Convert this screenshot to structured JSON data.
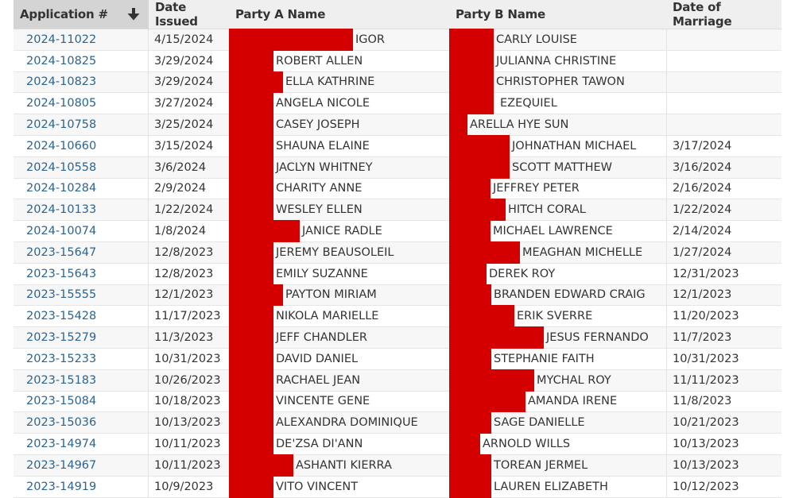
{
  "table": {
    "columns": [
      {
        "label": "Application #",
        "sorted": "descending"
      },
      {
        "label": "Date Issued"
      },
      {
        "label": "Party A Name"
      },
      {
        "label": "Party B Name"
      },
      {
        "label": "Date of Marriage"
      }
    ],
    "colors": {
      "link": "#2a6496",
      "redaction": "#d40000",
      "header_bg": "#efefef",
      "sorted_header_bg": "#d4d4d4"
    },
    "rows": [
      {
        "app": "2024-11022",
        "issued": "4/15/2024",
        "party_a": "IGOR",
        "party_b": "CARLY LOUISE",
        "married": ""
      },
      {
        "app": "2024-10825",
        "issued": "3/29/2024",
        "party_a": "ROBERT ALLEN",
        "party_b": "JULIANNA CHRISTINE",
        "married": ""
      },
      {
        "app": "2024-10823",
        "issued": "3/29/2024",
        "party_a": "ELLA KATHRINE",
        "party_b": "CHRISTOPHER TAWON",
        "married": ""
      },
      {
        "app": "2024-10805",
        "issued": "3/27/2024",
        "party_a": "ANGELA NICOLE",
        "party_b": "EZEQUIEL",
        "married": ""
      },
      {
        "app": "2024-10758",
        "issued": "3/25/2024",
        "party_a": "CASEY JOSEPH",
        "party_b": "ARELLA HYE SUN",
        "married": ""
      },
      {
        "app": "2024-10660",
        "issued": "3/15/2024",
        "party_a": "SHAUNA ELAINE",
        "party_b": "JOHNATHAN MICHAEL",
        "married": "3/17/2024"
      },
      {
        "app": "2024-10558",
        "issued": "3/6/2024",
        "party_a": "JACLYN WHITNEY",
        "party_b": "SCOTT MATTHEW",
        "married": "3/16/2024"
      },
      {
        "app": "2024-10284",
        "issued": "2/9/2024",
        "party_a": "CHARITY ANNE",
        "party_b": "JEFFREY PETER",
        "married": "2/16/2024"
      },
      {
        "app": "2024-10133",
        "issued": "1/22/2024",
        "party_a": "WESLEY ELLEN",
        "party_b": "HITCH CORAL",
        "married": "1/22/2024"
      },
      {
        "app": "2024-10074",
        "issued": "1/8/2024",
        "party_a": "JANICE RADLE",
        "party_b": "MICHAEL LAWRENCE",
        "married": "2/14/2024"
      },
      {
        "app": "2023-15647",
        "issued": "12/8/2023",
        "party_a": "JEREMY BEAUSOLEIL",
        "party_b": "MEAGHAN MICHELLE",
        "married": "1/27/2024"
      },
      {
        "app": "2023-15643",
        "issued": "12/8/2023",
        "party_a": "EMILY SUZANNE",
        "party_b": "DEREK ROY",
        "married": "12/31/2023"
      },
      {
        "app": "2023-15555",
        "issued": "12/1/2023",
        "party_a": "PAYTON MIRIAM",
        "party_b": "BRANDEN EDWARD CRAIG",
        "married": "12/1/2023"
      },
      {
        "app": "2023-15428",
        "issued": "11/17/2023",
        "party_a": "NIKOLA MARIELLE",
        "party_b": "ERIK SVERRE",
        "married": "11/20/2023"
      },
      {
        "app": "2023-15279",
        "issued": "11/3/2023",
        "party_a": "JEFF CHANDLER",
        "party_b": "JESUS FERNANDO",
        "married": "11/7/2023"
      },
      {
        "app": "2023-15233",
        "issued": "10/31/2023",
        "party_a": "DAVID DANIEL",
        "party_b": "STEPHANIE FAITH",
        "married": "10/31/2023"
      },
      {
        "app": "2023-15183",
        "issued": "10/26/2023",
        "party_a": "RACHAEL JEAN",
        "party_b": "MYCHAL ROY",
        "married": "11/11/2023"
      },
      {
        "app": "2023-15084",
        "issued": "10/18/2023",
        "party_a": "VINCENTE GENE",
        "party_b": "AMANDA IRENE",
        "married": "11/8/2023"
      },
      {
        "app": "2023-15036",
        "issued": "10/13/2023",
        "party_a": "ALEXANDRA DOMINIQUE",
        "party_b": "SAGE DANIELLE",
        "married": "10/21/2023"
      },
      {
        "app": "2023-14974",
        "issued": "10/11/2023",
        "party_a": "DE'ZSA DI'ANN",
        "party_b": "ARNOLD WILLS",
        "married": "10/13/2023"
      },
      {
        "app": "2023-14967",
        "issued": "10/11/2023",
        "party_a": "ASHANTI KIERRA",
        "party_b": "TOREAN JERMEL",
        "married": "10/13/2023"
      },
      {
        "app": "2023-14919",
        "issued": "10/9/2023",
        "party_a": "VITO VINCENT",
        "party_b": "LAUREN ELIZABETH",
        "married": "10/12/2023"
      }
    ]
  }
}
